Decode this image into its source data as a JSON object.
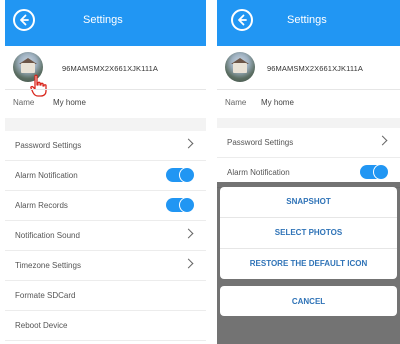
{
  "header": {
    "title": "Settings"
  },
  "profile": {
    "device_id": "96MAMSMX2X661XJK111A",
    "name_label": "Name",
    "name_value": "My home"
  },
  "left_rows": [
    {
      "label": "Password Settings",
      "control": "chevron"
    },
    {
      "label": "Alarm Notification",
      "control": "toggle-on"
    },
    {
      "label": "Alarm Records",
      "control": "toggle-on"
    },
    {
      "label": "Notification Sound",
      "control": "chevron"
    },
    {
      "label": "Timezone Settings",
      "control": "chevron"
    },
    {
      "label": "Formate SDCard",
      "control": "none"
    },
    {
      "label": "Reboot Device",
      "control": "none"
    }
  ],
  "right_rows": [
    {
      "label": "Password Settings",
      "control": "chevron"
    },
    {
      "label": "Alarm Notification",
      "control": "toggle-on"
    }
  ],
  "action_sheet": {
    "snapshot": "SNAPSHOT",
    "select_photos": "SELECT PHOTOS",
    "restore_icon": "RESTORE THE DEFAULT ICON",
    "cancel": "CANCEL"
  },
  "colors": {
    "accent": "#2196f3",
    "sheet_text": "#2f73b7"
  }
}
